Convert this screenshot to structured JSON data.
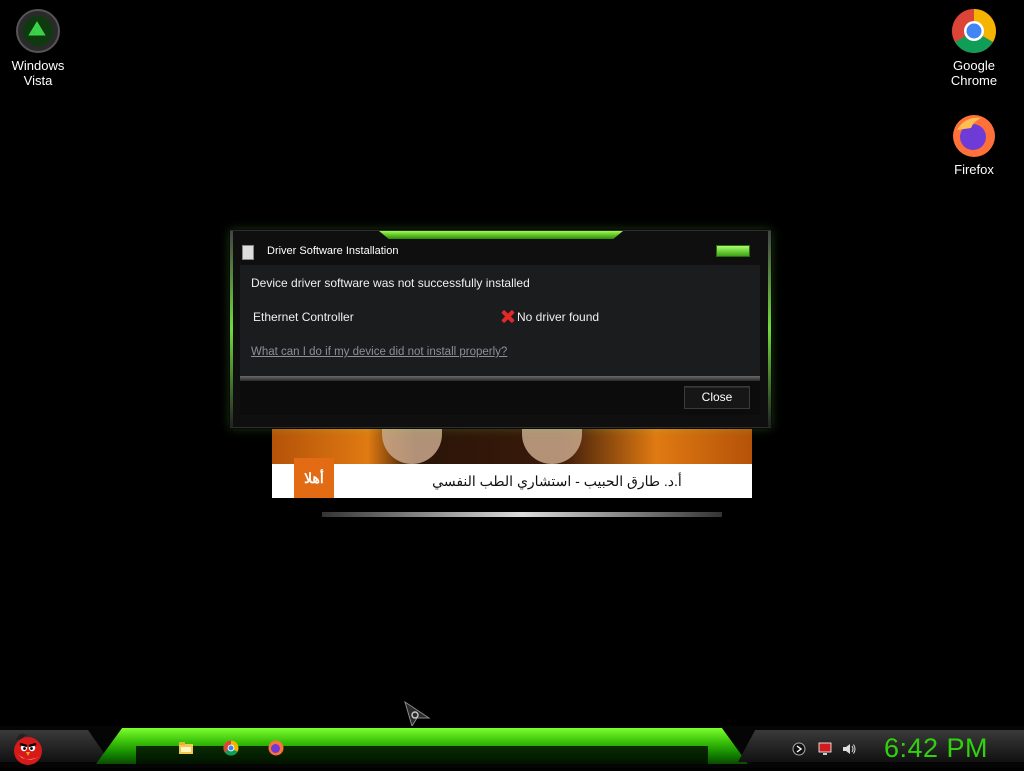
{
  "desktop": {
    "icons": [
      {
        "name": "Windows\nVista",
        "line1": "Windows",
        "line2": "Vista"
      },
      {
        "name": "Google Chrome",
        "line1": "Google",
        "line2": "Chrome"
      },
      {
        "name": "Firefox",
        "line1": "Firefox"
      }
    ]
  },
  "dialog": {
    "title": "Driver Software Installation",
    "headline": "Device driver software was not successfully installed",
    "device": "Ethernet Controller",
    "status": "No driver found",
    "help_link": "What can I do if my device did not install properly?",
    "close_label": "Close"
  },
  "video": {
    "logo": "أهلا",
    "caption": "أ.د. طارق الحبيب - استشاري الطب النفسي"
  },
  "taskbar": {
    "pinned": [
      "file-explorer-icon",
      "chrome-icon",
      "firefox-icon"
    ],
    "clock": "6:42 PM",
    "accent": "#32d10e"
  }
}
